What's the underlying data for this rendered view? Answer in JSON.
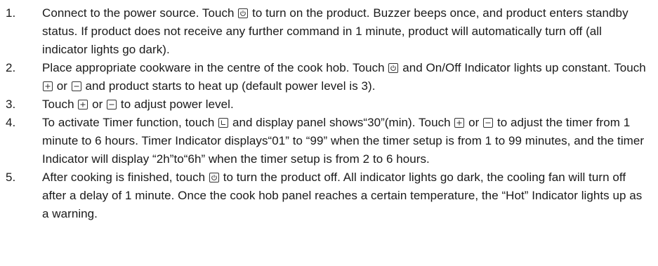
{
  "steps": [
    {
      "number": "1.",
      "parts": [
        "Connect to the power source. Touch ",
        " to turn on the product. Buzzer beeps once, and product enters standby status. If product does not receive any further command in 1 minute, product will automatically turn off (all indicator lights go dark)."
      ]
    },
    {
      "number": "2.",
      "parts": [
        "Place appropriate cookware in the centre of the cook hob. Touch ",
        " and On/Off Indicator lights up constant. Touch ",
        " or ",
        " and product starts to heat up (default power level is 3)."
      ]
    },
    {
      "number": "3.",
      "parts": [
        "Touch ",
        " or ",
        " to adjust power level."
      ]
    },
    {
      "number": "4.",
      "parts": [
        "To activate Timer function, touch ",
        " and display panel shows“30”(min). Touch ",
        " or ",
        " to adjust the timer from 1 minute to 6 hours. Timer Indicator displays“01” to “99” when the timer setup is from 1 to 99 minutes, and the timer Indicator will display “2h”to“6h” when the timer setup is from 2 to 6 hours."
      ]
    },
    {
      "number": "5.",
      "parts": [
        "After cooking is finished, touch ",
        " to turn the product off. All indicator lights go dark, the cooling fan will turn off after a delay of 1 minute. Once the cook hob panel reaches a certain temperature, the “Hot” Indicator lights up as a warning."
      ]
    }
  ],
  "icons": {
    "power": "power-icon",
    "plus": "plus-icon",
    "minus": "minus-icon",
    "timer": "timer-icon"
  }
}
